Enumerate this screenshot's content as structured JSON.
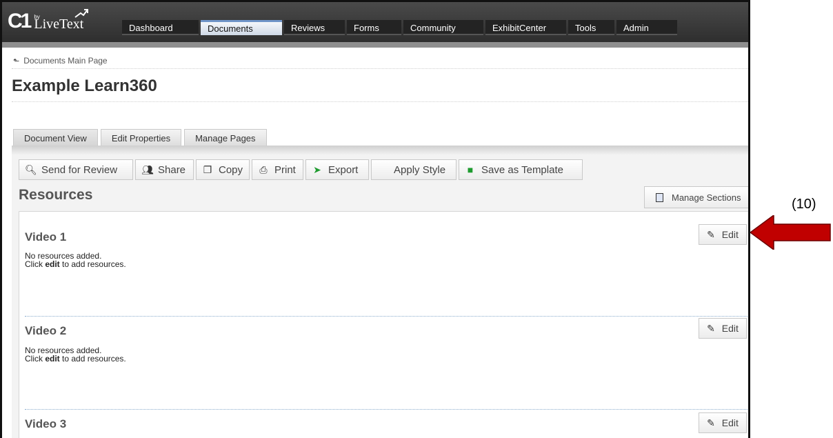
{
  "app": {
    "logo": {
      "by": "by",
      "name": "LiveText",
      "mark": "C1"
    },
    "nav": [
      {
        "label": "Dashboard",
        "active": false
      },
      {
        "label": "Documents",
        "active": true
      },
      {
        "label": "Reviews",
        "active": false
      },
      {
        "label": "Forms",
        "active": false
      },
      {
        "label": "Community",
        "active": false
      },
      {
        "label": "ExhibitCenter",
        "active": false
      },
      {
        "label": "Tools",
        "active": false
      },
      {
        "label": "Admin",
        "active": false
      }
    ]
  },
  "breadcrumb": {
    "label": "Documents Main Page"
  },
  "page": {
    "title": "Example Learn360"
  },
  "tabs": [
    {
      "label": "Document View",
      "active": true
    },
    {
      "label": "Edit Properties",
      "active": false
    },
    {
      "label": "Manage Pages",
      "active": false
    }
  ],
  "toolbar": {
    "send_for_review": "Send for Review",
    "share": "Share",
    "copy": "Copy",
    "print": "Print",
    "export": "Export",
    "apply_style": "Apply Style",
    "save_as_template": "Save as Template"
  },
  "resources": {
    "heading": "Resources",
    "manage_sections": "Manage Sections",
    "sections": [
      {
        "title": "Video 1",
        "line1": "No resources added.",
        "click": "Click ",
        "edit_word": "edit",
        "rest": " to add resources.",
        "edit_label": "Edit"
      },
      {
        "title": "Video 2",
        "line1": "No resources added.",
        "click": "Click ",
        "edit_word": "edit",
        "rest": " to add resources.",
        "edit_label": "Edit"
      },
      {
        "title": "Video 3",
        "edit_label": "Edit"
      }
    ]
  },
  "annotation": {
    "label": "(10)",
    "arrow_color": "#c00000"
  },
  "colors": {
    "topbar": "#2e2e2e",
    "active_tab_accent": "#6f95c9"
  }
}
